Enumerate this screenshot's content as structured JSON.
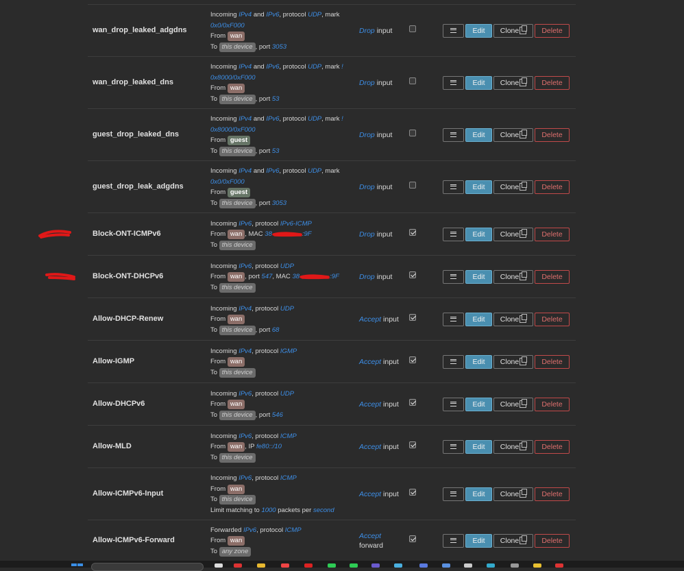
{
  "rules": [
    {
      "name": "wan_drop_leaked_adgdns",
      "lines": [
        [
          {
            "t": "Incoming "
          },
          {
            "v": "IPv4"
          },
          {
            "t": " and "
          },
          {
            "v": "IPv6"
          },
          {
            "t": ", protocol "
          },
          {
            "v": "UDP"
          },
          {
            "t": ", mark"
          }
        ],
        [
          {
            "v": "0x0/0xF000"
          }
        ],
        [
          {
            "t": "From "
          },
          {
            "z": "wan",
            "k": "wan"
          }
        ],
        [
          {
            "t": "To "
          },
          {
            "z": "this device",
            "k": "device"
          },
          {
            "t": ", port "
          },
          {
            "v": "3053"
          }
        ]
      ],
      "action": "Drop",
      "chain": "input",
      "enabled": false
    },
    {
      "name": "wan_drop_leaked_dns",
      "lines": [
        [
          {
            "t": "Incoming "
          },
          {
            "v": "IPv4"
          },
          {
            "t": " and "
          },
          {
            "v": "IPv6"
          },
          {
            "t": ", protocol "
          },
          {
            "v": "UDP"
          },
          {
            "t": ", mark "
          },
          {
            "v": "!"
          }
        ],
        [
          {
            "v": "0x8000/0xF000"
          }
        ],
        [
          {
            "t": "From "
          },
          {
            "z": "wan",
            "k": "wan"
          }
        ],
        [
          {
            "t": "To "
          },
          {
            "z": "this device",
            "k": "device"
          },
          {
            "t": ", port "
          },
          {
            "v": "53"
          }
        ]
      ],
      "action": "Drop",
      "chain": "input",
      "enabled": false
    },
    {
      "name": "guest_drop_leaked_dns",
      "lines": [
        [
          {
            "t": "Incoming "
          },
          {
            "v": "IPv4"
          },
          {
            "t": " and "
          },
          {
            "v": "IPv6"
          },
          {
            "t": ", protocol "
          },
          {
            "v": "UDP"
          },
          {
            "t": ", mark "
          },
          {
            "v": "!"
          }
        ],
        [
          {
            "v": "0x8000/0xF000"
          }
        ],
        [
          {
            "t": "From "
          },
          {
            "z": "guest",
            "k": "guest"
          }
        ],
        [
          {
            "t": "To "
          },
          {
            "z": "this device",
            "k": "device"
          },
          {
            "t": ", port "
          },
          {
            "v": "53"
          }
        ]
      ],
      "action": "Drop",
      "chain": "input",
      "enabled": false
    },
    {
      "name": "guest_drop_leak_adgdns",
      "lines": [
        [
          {
            "t": "Incoming "
          },
          {
            "v": "IPv4"
          },
          {
            "t": " and "
          },
          {
            "v": "IPv6"
          },
          {
            "t": ", protocol "
          },
          {
            "v": "UDP"
          },
          {
            "t": ", mark"
          }
        ],
        [
          {
            "v": "0x0/0xF000"
          }
        ],
        [
          {
            "t": "From "
          },
          {
            "z": "guest",
            "k": "guest"
          }
        ],
        [
          {
            "t": "To "
          },
          {
            "z": "this device",
            "k": "device"
          },
          {
            "t": ", port "
          },
          {
            "v": "3053"
          }
        ]
      ],
      "action": "Drop",
      "chain": "input",
      "enabled": false
    },
    {
      "name": "Block-ONT-ICMPv6",
      "lines": [
        [
          {
            "t": "Incoming "
          },
          {
            "v": "IPv6"
          },
          {
            "t": ", protocol "
          },
          {
            "v": "IPv6-ICMP"
          }
        ],
        [
          {
            "t": "From "
          },
          {
            "z": "wan",
            "k": "wan"
          },
          {
            "t": ", MAC "
          },
          {
            "v": "38"
          },
          {
            "redact": true
          },
          {
            "v": ":9F"
          }
        ],
        [
          {
            "t": "To "
          },
          {
            "z": "this device",
            "k": "device"
          }
        ]
      ],
      "action": "Drop",
      "chain": "input",
      "enabled": true
    },
    {
      "name": "Block-ONT-DHCPv6",
      "lines": [
        [
          {
            "t": "Incoming "
          },
          {
            "v": "IPv6"
          },
          {
            "t": ", protocol "
          },
          {
            "v": "UDP"
          }
        ],
        [
          {
            "t": "From "
          },
          {
            "z": "wan",
            "k": "wan"
          },
          {
            "t": ", port "
          },
          {
            "v": "547"
          },
          {
            "t": ", MAC "
          },
          {
            "v": "38"
          },
          {
            "redact": true
          },
          {
            "v": ":9F"
          }
        ],
        [
          {
            "t": "To "
          },
          {
            "z": "this device",
            "k": "device"
          }
        ]
      ],
      "action": "Drop",
      "chain": "input",
      "enabled": true
    },
    {
      "name": "Allow-DHCP-Renew",
      "lines": [
        [
          {
            "t": "Incoming "
          },
          {
            "v": "IPv4"
          },
          {
            "t": ", protocol "
          },
          {
            "v": "UDP"
          }
        ],
        [
          {
            "t": "From "
          },
          {
            "z": "wan",
            "k": "wan"
          }
        ],
        [
          {
            "t": "To "
          },
          {
            "z": "this device",
            "k": "device"
          },
          {
            "t": ", port "
          },
          {
            "v": "68"
          }
        ]
      ],
      "action": "Accept",
      "chain": "input",
      "enabled": true
    },
    {
      "name": "Allow-IGMP",
      "lines": [
        [
          {
            "t": "Incoming "
          },
          {
            "v": "IPv4"
          },
          {
            "t": ", protocol "
          },
          {
            "v": "IGMP"
          }
        ],
        [
          {
            "t": "From "
          },
          {
            "z": "wan",
            "k": "wan"
          }
        ],
        [
          {
            "t": "To "
          },
          {
            "z": "this device",
            "k": "device"
          }
        ]
      ],
      "action": "Accept",
      "chain": "input",
      "enabled": true
    },
    {
      "name": "Allow-DHCPv6",
      "lines": [
        [
          {
            "t": "Incoming "
          },
          {
            "v": "IPv6"
          },
          {
            "t": ", protocol "
          },
          {
            "v": "UDP"
          }
        ],
        [
          {
            "t": "From "
          },
          {
            "z": "wan",
            "k": "wan"
          }
        ],
        [
          {
            "t": "To "
          },
          {
            "z": "this device",
            "k": "device"
          },
          {
            "t": ", port "
          },
          {
            "v": "546"
          }
        ]
      ],
      "action": "Accept",
      "chain": "input",
      "enabled": true
    },
    {
      "name": "Allow-MLD",
      "lines": [
        [
          {
            "t": "Incoming "
          },
          {
            "v": "IPv6"
          },
          {
            "t": ", protocol "
          },
          {
            "v": "ICMP"
          }
        ],
        [
          {
            "t": "From "
          },
          {
            "z": "wan",
            "k": "wan"
          },
          {
            "t": ", IP "
          },
          {
            "v": "fe80::/10"
          }
        ],
        [
          {
            "t": "To "
          },
          {
            "z": "this device",
            "k": "device"
          }
        ]
      ],
      "action": "Accept",
      "chain": "input",
      "enabled": true
    },
    {
      "name": "Allow-ICMPv6-Input",
      "lines": [
        [
          {
            "t": "Incoming "
          },
          {
            "v": "IPv6"
          },
          {
            "t": ", protocol "
          },
          {
            "v": "ICMP"
          }
        ],
        [
          {
            "t": "From "
          },
          {
            "z": "wan",
            "k": "wan"
          }
        ],
        [
          {
            "t": "To "
          },
          {
            "z": "this device",
            "k": "device"
          }
        ],
        [
          {
            "t": "Limit matching to "
          },
          {
            "v": "1000"
          },
          {
            "t": " packets per "
          },
          {
            "v": "second"
          }
        ]
      ],
      "action": "Accept",
      "chain": "input",
      "enabled": true
    },
    {
      "name": "Allow-ICMPv6-Forward",
      "lines": [
        [
          {
            "t": "Forwarded "
          },
          {
            "v": "IPv6"
          },
          {
            "t": ", protocol "
          },
          {
            "v": "ICMP"
          }
        ],
        [
          {
            "t": "From "
          },
          {
            "z": "wan",
            "k": "wan"
          }
        ],
        [
          {
            "t": "To "
          },
          {
            "z": "any zone",
            "k": "anyzone"
          }
        ]
      ],
      "action": "Accept",
      "chain": "forward",
      "enabled": true
    }
  ],
  "buttons": {
    "edit": "Edit",
    "clone": "Clone",
    "delete": "Delete"
  },
  "colors": {
    "background": "#2b2b2b",
    "accent": "#4a8fb0",
    "link": "#3d8fe8",
    "danger": "#c24a4a",
    "wan_zone": "#8c6e68",
    "guest_zone": "#667566"
  },
  "icons": {
    "menu": "hamburger-icon",
    "clone": "copy-icon"
  }
}
